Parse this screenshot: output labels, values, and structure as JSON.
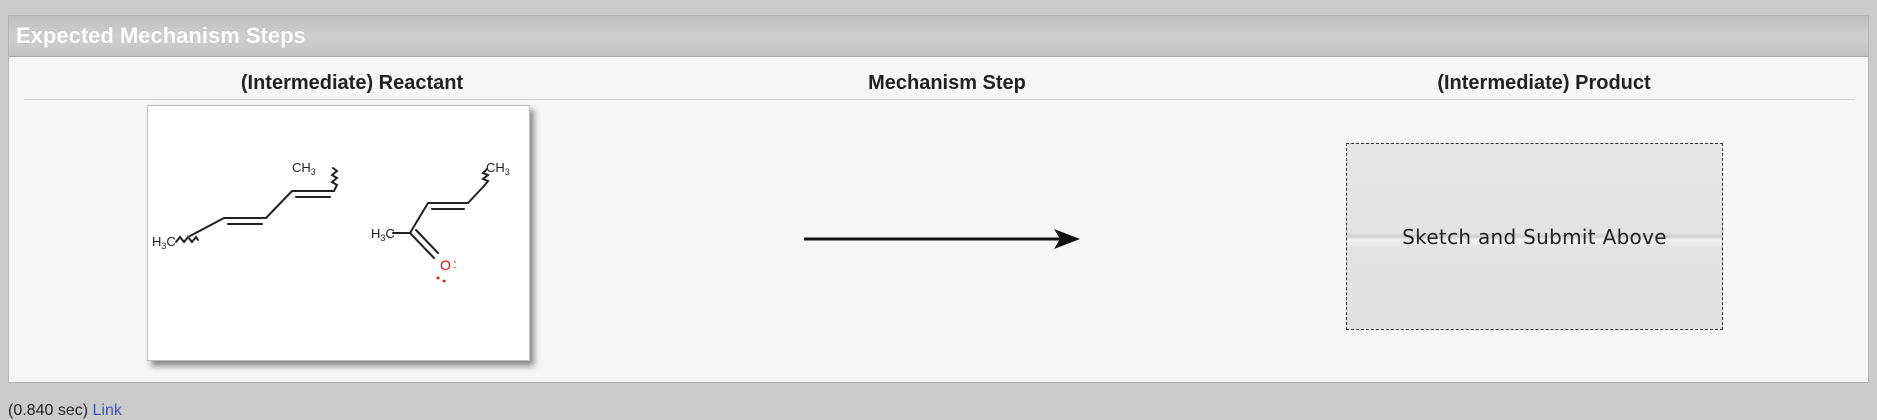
{
  "panel": {
    "title": "Expected Mechanism Steps"
  },
  "columns": {
    "reactant": "(Intermediate) Reactant",
    "step": "Mechanism Step",
    "product": "(Intermediate) Product"
  },
  "molecules": {
    "labels": {
      "ch3": "CH",
      "three": "3",
      "h3c_h": "H",
      "h3c_c": "C",
      "oxygen": "O",
      "dots": ":"
    }
  },
  "product": {
    "placeholder": "Sketch and Submit Above"
  },
  "footer": {
    "timing": "(0.840 sec)",
    "link": "Link"
  },
  "colors": {
    "oxygen": "#ff0000",
    "link": "#3a55b4"
  }
}
